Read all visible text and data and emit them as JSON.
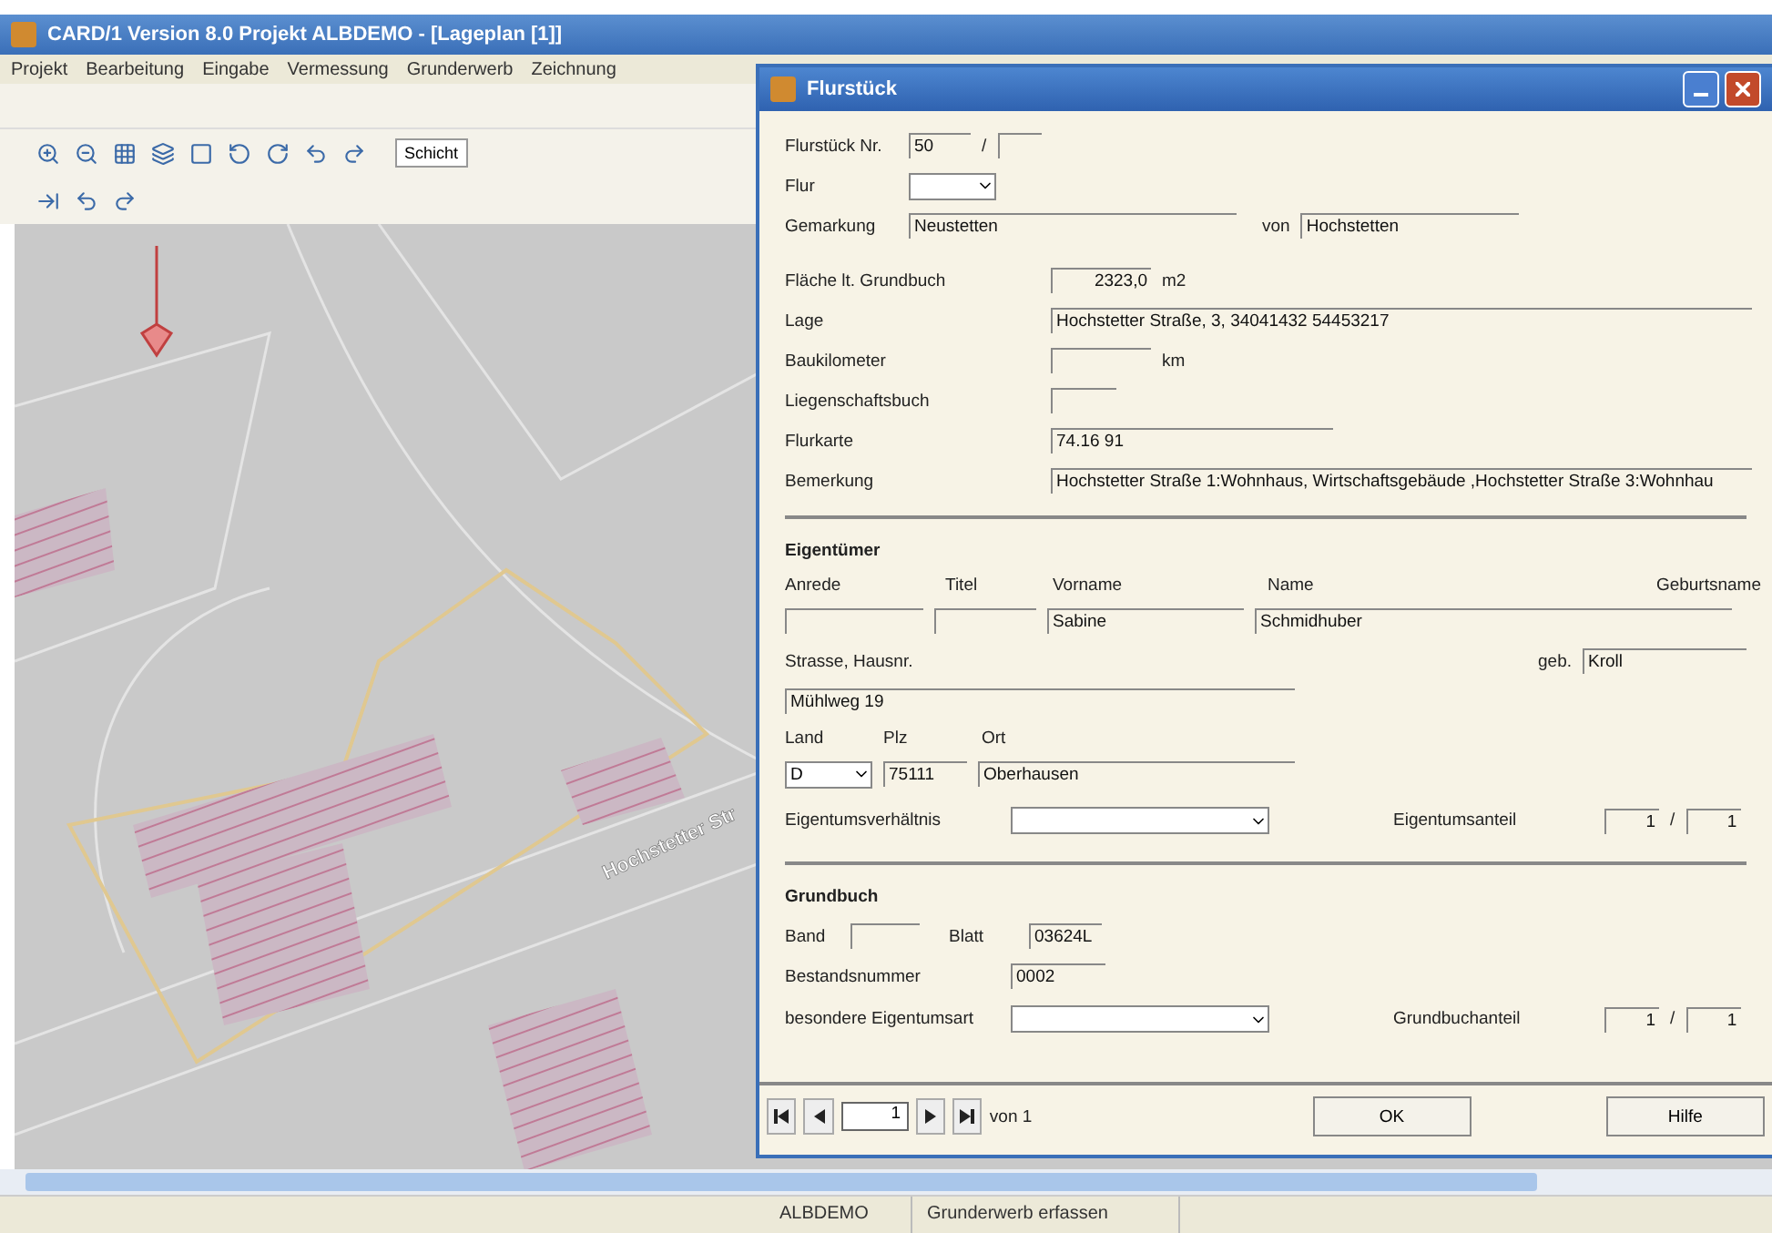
{
  "window": {
    "title": "CARD/1 Version 8.0 Projekt ALBDEMO - [Lageplan [1]]",
    "menu": [
      "Projekt",
      "Bearbeitung",
      "Eingabe",
      "Vermessung",
      "Grunderwerb",
      "Zeichnung"
    ],
    "layer_combo": "Schicht"
  },
  "map": {
    "road_label": "Hochstetter Str"
  },
  "dialog": {
    "title": "Flurstück",
    "top": [
      {
        "label": "Flurstück Nr.",
        "value": "50",
        "sep": "/"
      },
      {
        "label": "Flur",
        "kind": "combo"
      },
      {
        "label": "Gemarkung",
        "value": "Neustetten",
        "von_label": "von",
        "von_value": "Hochstetten"
      }
    ],
    "details": [
      {
        "label": "Fläche lt. Grundbuch",
        "value": "2323,0",
        "unit": "m2",
        "kind": "short"
      },
      {
        "label": "Lage",
        "value": "Hochstetter Straße, 3, 34041432 54453217",
        "kind": "wide"
      },
      {
        "label": "Baukilometer",
        "unit": "km",
        "kind": "short"
      },
      {
        "label": "Liegenschaftsbuch",
        "kind": "tiny"
      },
      {
        "label": "Flurkarte",
        "value": "74.16  91",
        "kind": "mid"
      },
      {
        "label": "Bemerkung",
        "value": "Hochstetter Straße 1:Wohnhaus, Wirtschaftsgebäude ,Hochstetter Straße 3:Wohnhau",
        "kind": "wide"
      }
    ],
    "owner": {
      "heading": "Eigentümer",
      "columns": [
        "Anrede",
        "Titel",
        "Vorname",
        "Name",
        "Geburtsname"
      ],
      "vorname": "Sabine",
      "name": "Schmidhuber",
      "street_label": "Strasse, Hausnr.",
      "street": "Mühlweg 19",
      "geb_label": "geb.",
      "geb": "Kroll",
      "land_label": "Land",
      "plz_label": "Plz",
      "ort_label": "Ort",
      "land": "D",
      "plz": "75111",
      "ort": "Oberhausen",
      "verh_label": "Eigentumsverhältnis",
      "anteil_label": "Eigentumsanteil",
      "anteil_a": "1",
      "anteil_sep": "/",
      "anteil_b": "1"
    },
    "grundbuch": {
      "heading": "Grundbuch",
      "band_label": "Band",
      "blatt_label": "Blatt",
      "blatt": "03624L",
      "bestand_label": "Bestandsnummer",
      "bestand": "0002",
      "art_label": "besondere Eigentumsart",
      "anteil_label": "Grundbuchanteil",
      "anteil_a": "1",
      "anteil_sep": "/",
      "anteil_b": "1"
    },
    "nav": {
      "record": "1",
      "of": "von 1"
    },
    "buttons": [
      "OK",
      "Hilfe"
    ]
  },
  "status_bar": [
    "ALBDEMO",
    "Grunderwerb erfassen"
  ]
}
